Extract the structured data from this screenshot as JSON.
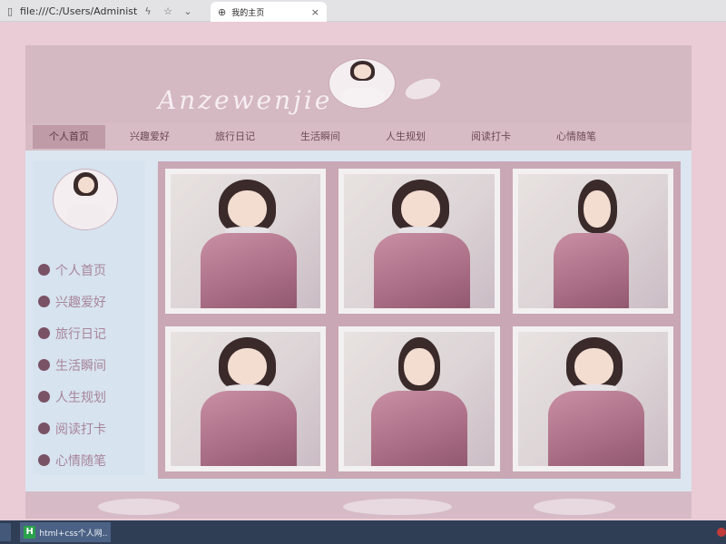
{
  "browser": {
    "address": "file:///C:/Users/Administrator",
    "tab_title": "我的主页",
    "tab_close": "×"
  },
  "header": {
    "logo": "Anzewenjie"
  },
  "nav": [
    {
      "label": "个人首页",
      "active": true
    },
    {
      "label": "兴趣爱好"
    },
    {
      "label": "旅行日记"
    },
    {
      "label": "生活瞬间"
    },
    {
      "label": "人生规划"
    },
    {
      "label": "阅读打卡"
    },
    {
      "label": "心情随笔"
    }
  ],
  "sidebar": {
    "items": [
      {
        "label": "个人首页"
      },
      {
        "label": "兴趣爱好"
      },
      {
        "label": "旅行日记"
      },
      {
        "label": "生活瞬间"
      },
      {
        "label": "人生规划"
      },
      {
        "label": "阅读打卡"
      },
      {
        "label": "心情随笔"
      }
    ]
  },
  "gallery": {
    "photo_count": 6
  },
  "taskbar": {
    "app_icon": "H",
    "app_title": "html+css个人网..."
  }
}
